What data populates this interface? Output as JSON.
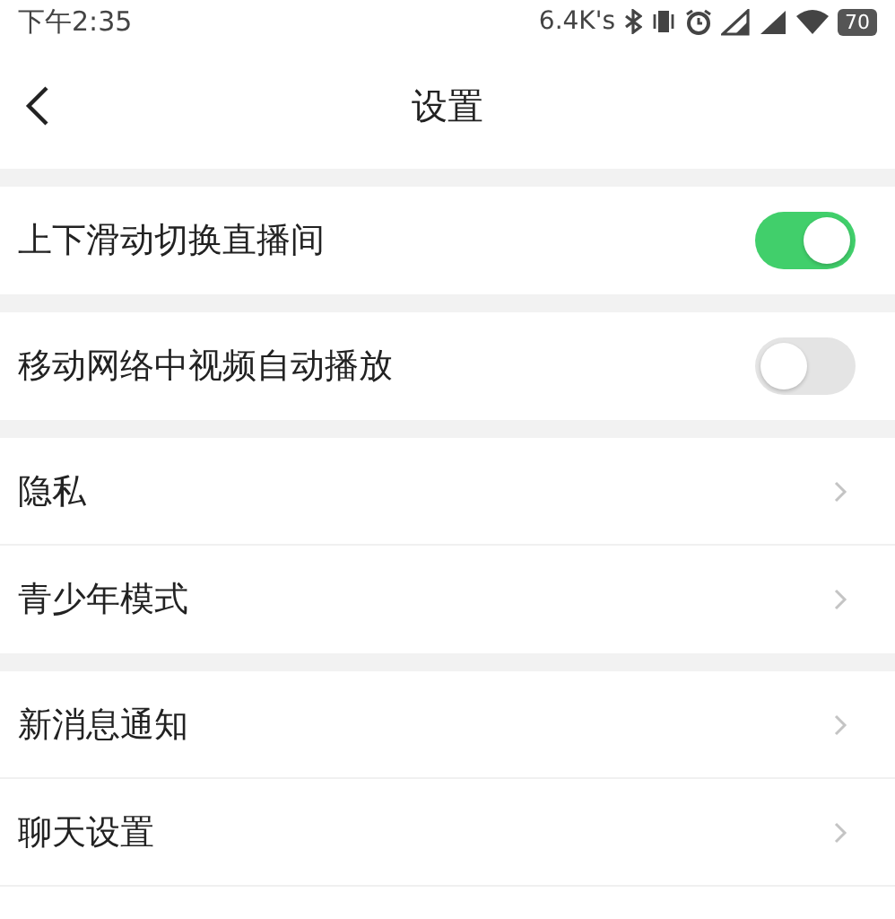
{
  "status_bar": {
    "time": "下午2:35",
    "speed": "6.4K's",
    "battery": "70"
  },
  "header": {
    "title": "设置"
  },
  "groups": [
    {
      "items": [
        {
          "kind": "toggle",
          "label": "上下滑动切换直播间",
          "on": true
        }
      ]
    },
    {
      "items": [
        {
          "kind": "toggle",
          "label": "移动网络中视频自动播放",
          "on": false
        }
      ]
    },
    {
      "items": [
        {
          "kind": "link",
          "label": "隐私"
        },
        {
          "kind": "link",
          "label": "青少年模式"
        }
      ]
    },
    {
      "items": [
        {
          "kind": "link",
          "label": "新消息通知"
        },
        {
          "kind": "link",
          "label": "聊天设置"
        }
      ]
    }
  ]
}
